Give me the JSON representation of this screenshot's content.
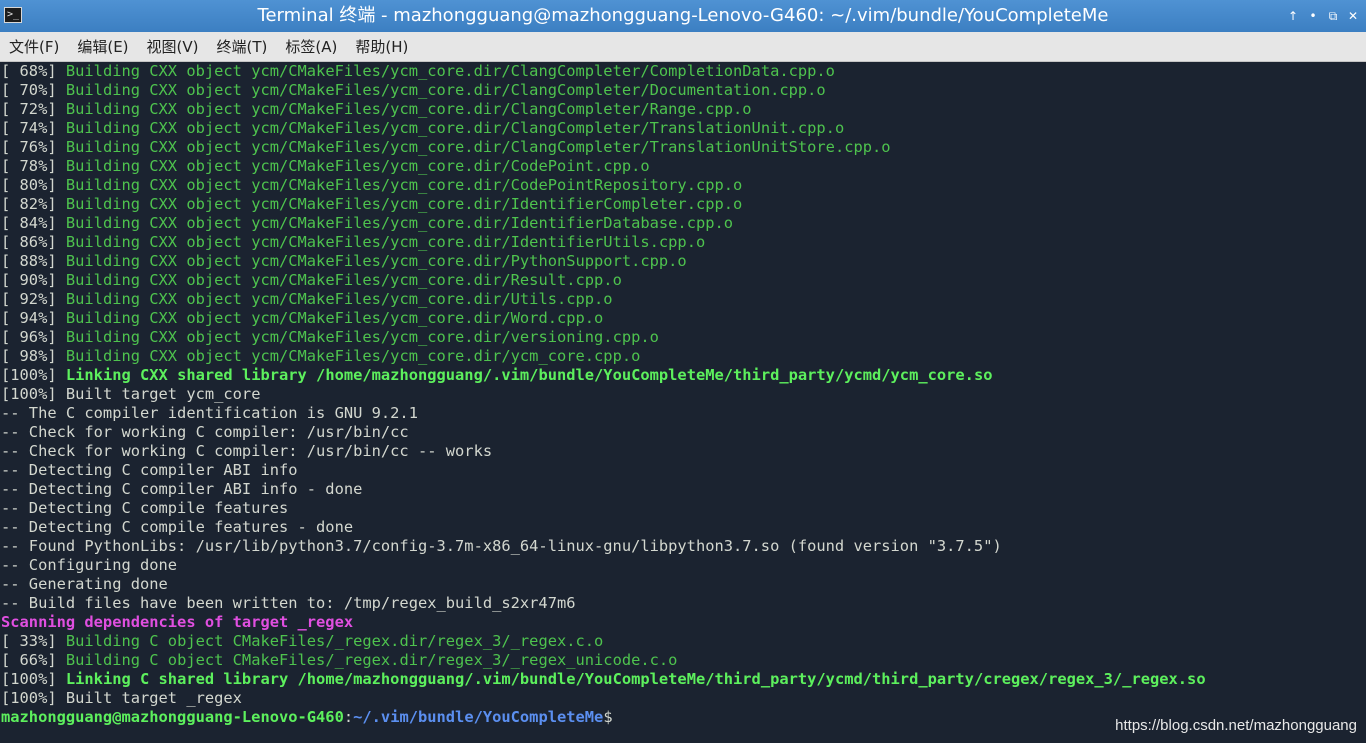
{
  "window": {
    "title": "Terminal 终端 - mazhongguang@mazhongguang-Lenovo-G460: ~/.vim/bundle/YouCompleteMe",
    "app_icon_glyph": ">_",
    "controls": {
      "up": "↑",
      "minimize": "•",
      "maximize": "⧉",
      "close": "✕"
    }
  },
  "menu": [
    {
      "label": "文件(F)"
    },
    {
      "label": "编辑(E)"
    },
    {
      "label": "视图(V)"
    },
    {
      "label": "终端(T)"
    },
    {
      "label": "标签(A)"
    },
    {
      "label": "帮助(H)"
    }
  ],
  "terminal": {
    "lines": [
      {
        "p": "[ 68%] ",
        "t": "Building CXX object ycm/CMakeFiles/ycm_core.dir/ClangCompleter/CompletionData.cpp.o",
        "s": "g"
      },
      {
        "p": "[ 70%] ",
        "t": "Building CXX object ycm/CMakeFiles/ycm_core.dir/ClangCompleter/Documentation.cpp.o",
        "s": "g"
      },
      {
        "p": "[ 72%] ",
        "t": "Building CXX object ycm/CMakeFiles/ycm_core.dir/ClangCompleter/Range.cpp.o",
        "s": "g"
      },
      {
        "p": "[ 74%] ",
        "t": "Building CXX object ycm/CMakeFiles/ycm_core.dir/ClangCompleter/TranslationUnit.cpp.o",
        "s": "g"
      },
      {
        "p": "[ 76%] ",
        "t": "Building CXX object ycm/CMakeFiles/ycm_core.dir/ClangCompleter/TranslationUnitStore.cpp.o",
        "s": "g"
      },
      {
        "p": "[ 78%] ",
        "t": "Building CXX object ycm/CMakeFiles/ycm_core.dir/CodePoint.cpp.o",
        "s": "g"
      },
      {
        "p": "[ 80%] ",
        "t": "Building CXX object ycm/CMakeFiles/ycm_core.dir/CodePointRepository.cpp.o",
        "s": "g"
      },
      {
        "p": "[ 82%] ",
        "t": "Building CXX object ycm/CMakeFiles/ycm_core.dir/IdentifierCompleter.cpp.o",
        "s": "g"
      },
      {
        "p": "[ 84%] ",
        "t": "Building CXX object ycm/CMakeFiles/ycm_core.dir/IdentifierDatabase.cpp.o",
        "s": "g"
      },
      {
        "p": "[ 86%] ",
        "t": "Building CXX object ycm/CMakeFiles/ycm_core.dir/IdentifierUtils.cpp.o",
        "s": "g"
      },
      {
        "p": "[ 88%] ",
        "t": "Building CXX object ycm/CMakeFiles/ycm_core.dir/PythonSupport.cpp.o",
        "s": "g"
      },
      {
        "p": "[ 90%] ",
        "t": "Building CXX object ycm/CMakeFiles/ycm_core.dir/Result.cpp.o",
        "s": "g"
      },
      {
        "p": "[ 92%] ",
        "t": "Building CXX object ycm/CMakeFiles/ycm_core.dir/Utils.cpp.o",
        "s": "g"
      },
      {
        "p": "[ 94%] ",
        "t": "Building CXX object ycm/CMakeFiles/ycm_core.dir/Word.cpp.o",
        "s": "g"
      },
      {
        "p": "[ 96%] ",
        "t": "Building CXX object ycm/CMakeFiles/ycm_core.dir/versioning.cpp.o",
        "s": "g"
      },
      {
        "p": "[ 98%] ",
        "t": "Building CXX object ycm/CMakeFiles/ycm_core.dir/ycm_core.cpp.o",
        "s": "g"
      },
      {
        "p": "[100%] ",
        "t": "Linking CXX shared library /home/mazhongguang/.vim/bundle/YouCompleteMe/third_party/ycmd/ycm_core.so",
        "s": "gb"
      },
      {
        "p": "[100%] ",
        "t": "Built target ycm_core",
        "s": "w"
      },
      {
        "p": "",
        "t": "-- The C compiler identification is GNU 9.2.1",
        "s": "w"
      },
      {
        "p": "",
        "t": "-- Check for working C compiler: /usr/bin/cc",
        "s": "w"
      },
      {
        "p": "",
        "t": "-- Check for working C compiler: /usr/bin/cc -- works",
        "s": "w"
      },
      {
        "p": "",
        "t": "-- Detecting C compiler ABI info",
        "s": "w"
      },
      {
        "p": "",
        "t": "-- Detecting C compiler ABI info - done",
        "s": "w"
      },
      {
        "p": "",
        "t": "-- Detecting C compile features",
        "s": "w"
      },
      {
        "p": "",
        "t": "-- Detecting C compile features - done",
        "s": "w"
      },
      {
        "p": "",
        "t": "-- Found PythonLibs: /usr/lib/python3.7/config-3.7m-x86_64-linux-gnu/libpython3.7.so (found version \"3.7.5\")",
        "s": "w"
      },
      {
        "p": "",
        "t": "-- Configuring done",
        "s": "w"
      },
      {
        "p": "",
        "t": "-- Generating done",
        "s": "w"
      },
      {
        "p": "",
        "t": "-- Build files have been written to: /tmp/regex_build_s2xr47m6",
        "s": "w"
      },
      {
        "p": "",
        "t": "Scanning dependencies of target _regex",
        "s": "m"
      },
      {
        "p": "[ 33%] ",
        "t": "Building C object CMakeFiles/_regex.dir/regex_3/_regex.c.o",
        "s": "g"
      },
      {
        "p": "[ 66%] ",
        "t": "Building C object CMakeFiles/_regex.dir/regex_3/_regex_unicode.c.o",
        "s": "g"
      },
      {
        "p": "[100%] ",
        "t": "Linking C shared library /home/mazhongguang/.vim/bundle/YouCompleteMe/third_party/ycmd/third_party/cregex/regex_3/_regex.so",
        "s": "gb"
      },
      {
        "p": "[100%] ",
        "t": "Built target _regex",
        "s": "w"
      }
    ],
    "prompt": {
      "user_host": "mazhongguang@mazhongguang-Lenovo-G460",
      "separator": ":",
      "path": "~/.vim/bundle/YouCompleteMe",
      "symbol": "$"
    }
  },
  "watermark": "https://blog.csdn.net/mazhongguang",
  "colors": {
    "background": "#1b2330",
    "green": "#4ec34e",
    "bright_green": "#5df05d",
    "magenta": "#e04fe0",
    "blue": "#5b8ff0",
    "titlebar": "#4f92d3"
  }
}
